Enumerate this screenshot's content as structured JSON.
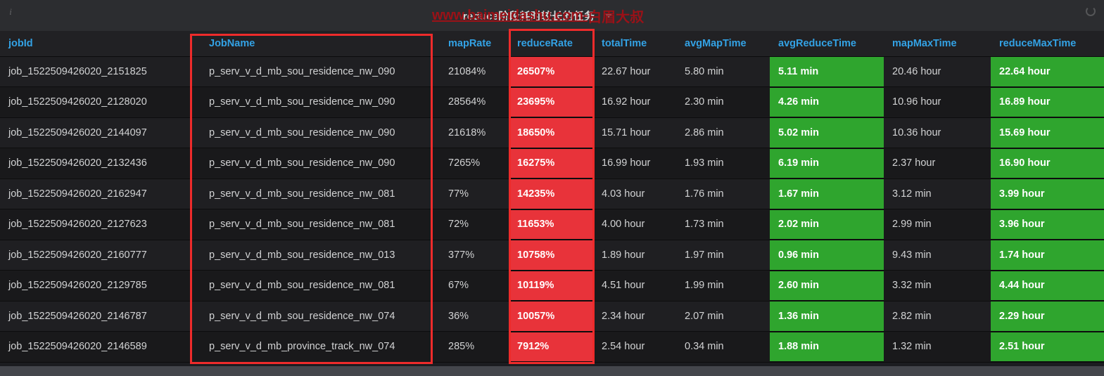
{
  "panel": {
    "title": "reduce阶段耗时较长的任务",
    "info_icon": "i",
    "spinner_icon": "loading-spinner-icon",
    "caret_icon": "chevron-down-icon"
  },
  "watermark": {
    "url": "www.baimeidashu.com-",
    "cn": "白眉大叔"
  },
  "table": {
    "columns": [
      {
        "key": "jobId",
        "label": "jobId"
      },
      {
        "key": "jobName",
        "label": "JobName"
      },
      {
        "key": "mapRate",
        "label": "mapRate"
      },
      {
        "key": "reduceRate",
        "label": "reduceRate"
      },
      {
        "key": "totalTime",
        "label": "totalTime"
      },
      {
        "key": "avgMapTime",
        "label": "avgMapTime"
      },
      {
        "key": "avgReduceTime",
        "label": "avgReduceTime"
      },
      {
        "key": "mapMaxTime",
        "label": "mapMaxTime"
      },
      {
        "key": "reduceMaxTime",
        "label": "reduceMaxTime"
      }
    ],
    "rows": [
      {
        "jobId": "job_1522509426020_2151825",
        "jobName": "p_serv_v_d_mb_sou_residence_nw_090",
        "mapRate": "21084%",
        "reduceRate": "26507%",
        "totalTime": "22.67 hour",
        "avgMapTime": "5.80 min",
        "avgReduceTime": "5.11 min",
        "mapMaxTime": "20.46 hour",
        "reduceMaxTime": "22.64 hour"
      },
      {
        "jobId": "job_1522509426020_2128020",
        "jobName": "p_serv_v_d_mb_sou_residence_nw_090",
        "mapRate": "28564%",
        "reduceRate": "23695%",
        "totalTime": "16.92 hour",
        "avgMapTime": "2.30 min",
        "avgReduceTime": "4.26 min",
        "mapMaxTime": "10.96 hour",
        "reduceMaxTime": "16.89 hour"
      },
      {
        "jobId": "job_1522509426020_2144097",
        "jobName": "p_serv_v_d_mb_sou_residence_nw_090",
        "mapRate": "21618%",
        "reduceRate": "18650%",
        "totalTime": "15.71 hour",
        "avgMapTime": "2.86 min",
        "avgReduceTime": "5.02 min",
        "mapMaxTime": "10.36 hour",
        "reduceMaxTime": "15.69 hour"
      },
      {
        "jobId": "job_1522509426020_2132436",
        "jobName": "p_serv_v_d_mb_sou_residence_nw_090",
        "mapRate": "7265%",
        "reduceRate": "16275%",
        "totalTime": "16.99 hour",
        "avgMapTime": "1.93 min",
        "avgReduceTime": "6.19 min",
        "mapMaxTime": "2.37 hour",
        "reduceMaxTime": "16.90 hour"
      },
      {
        "jobId": "job_1522509426020_2162947",
        "jobName": "p_serv_v_d_mb_sou_residence_nw_081",
        "mapRate": "77%",
        "reduceRate": "14235%",
        "totalTime": "4.03 hour",
        "avgMapTime": "1.76 min",
        "avgReduceTime": "1.67 min",
        "mapMaxTime": "3.12 min",
        "reduceMaxTime": "3.99 hour"
      },
      {
        "jobId": "job_1522509426020_2127623",
        "jobName": "p_serv_v_d_mb_sou_residence_nw_081",
        "mapRate": "72%",
        "reduceRate": "11653%",
        "totalTime": "4.00 hour",
        "avgMapTime": "1.73 min",
        "avgReduceTime": "2.02 min",
        "mapMaxTime": "2.99 min",
        "reduceMaxTime": "3.96 hour"
      },
      {
        "jobId": "job_1522509426020_2160777",
        "jobName": "p_serv_v_d_mb_sou_residence_nw_013",
        "mapRate": "377%",
        "reduceRate": "10758%",
        "totalTime": "1.89 hour",
        "avgMapTime": "1.97 min",
        "avgReduceTime": "0.96 min",
        "mapMaxTime": "9.43 min",
        "reduceMaxTime": "1.74 hour"
      },
      {
        "jobId": "job_1522509426020_2129785",
        "jobName": "p_serv_v_d_mb_sou_residence_nw_081",
        "mapRate": "67%",
        "reduceRate": "10119%",
        "totalTime": "4.51 hour",
        "avgMapTime": "1.99 min",
        "avgReduceTime": "2.60 min",
        "mapMaxTime": "3.32 min",
        "reduceMaxTime": "4.44 hour"
      },
      {
        "jobId": "job_1522509426020_2146787",
        "jobName": "p_serv_v_d_mb_sou_residence_nw_074",
        "mapRate": "36%",
        "reduceRate": "10057%",
        "totalTime": "2.34 hour",
        "avgMapTime": "2.07 min",
        "avgReduceTime": "1.36 min",
        "mapMaxTime": "2.82 min",
        "reduceMaxTime": "2.29 hour"
      },
      {
        "jobId": "job_1522509426020_2146589",
        "jobName": "p_serv_v_d_mb_province_track_nw_074",
        "mapRate": "285%",
        "reduceRate": "7912%",
        "totalTime": "2.54 hour",
        "avgMapTime": "0.34 min",
        "avgReduceTime": "1.88 min",
        "mapMaxTime": "1.32 min",
        "reduceMaxTime": "2.51 hour"
      }
    ]
  },
  "colors": {
    "header_text": "#33a2e5",
    "cell_red": "#e8333a",
    "cell_green": "#2fa52e",
    "annotation": "#ee2b2b",
    "panel_bg": "#212124"
  },
  "annotations": [
    {
      "name": "jobname-highlight",
      "target": "JobName"
    },
    {
      "name": "reducerate-highlight",
      "target": "reduceRate"
    }
  ]
}
